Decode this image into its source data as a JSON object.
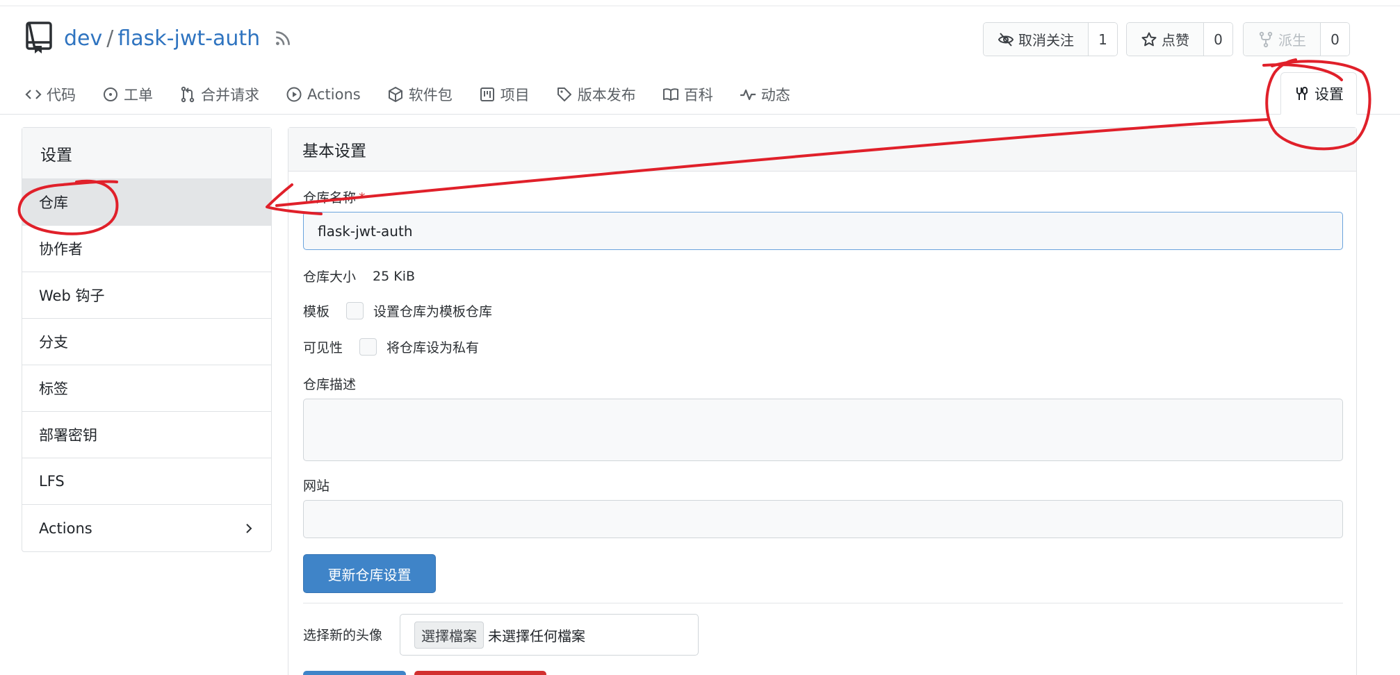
{
  "header": {
    "owner": "dev",
    "separator": "/",
    "repo_name": "flask-jwt-auth"
  },
  "actions": {
    "watch": {
      "label": "取消关注",
      "count": "1"
    },
    "star": {
      "label": "点赞",
      "count": "0"
    },
    "fork": {
      "label": "派生",
      "count": "0"
    }
  },
  "tabs": [
    {
      "label": "代码",
      "icon": "code-icon"
    },
    {
      "label": "工单",
      "icon": "issue-icon"
    },
    {
      "label": "合并请求",
      "icon": "pull-request-icon"
    },
    {
      "label": "Actions",
      "icon": "play-icon"
    },
    {
      "label": "软件包",
      "icon": "package-icon"
    },
    {
      "label": "项目",
      "icon": "project-icon"
    },
    {
      "label": "版本发布",
      "icon": "tag-icon"
    },
    {
      "label": "百科",
      "icon": "book-icon"
    },
    {
      "label": "动态",
      "icon": "pulse-icon"
    }
  ],
  "settings_tab": {
    "label": "设置",
    "icon": "tools-icon"
  },
  "sidebar": {
    "title": "设置",
    "items": [
      {
        "label": "仓库",
        "active": true
      },
      {
        "label": "协作者"
      },
      {
        "label": "Web 钩子"
      },
      {
        "label": "分支"
      },
      {
        "label": "标签"
      },
      {
        "label": "部署密钥"
      },
      {
        "label": "LFS"
      },
      {
        "label": "Actions"
      }
    ]
  },
  "main": {
    "panel_title": "基本设置",
    "repo_name_label": "仓库名称",
    "required_mark": "*",
    "repo_name_value": "flask-jwt-auth",
    "size_label": "仓库大小",
    "size_value": "25 KiB",
    "template_label": "模板",
    "template_checkbox_label": "设置仓库为模板仓库",
    "visibility_label": "可见性",
    "visibility_checkbox_label": "将仓库设为私有",
    "description_label": "仓库描述",
    "website_label": "网站",
    "update_button": "更新仓库设置",
    "avatar_label": "选择新的头像",
    "file_button": "選擇檔案",
    "file_none": "未選擇任何檔案"
  },
  "colors": {
    "link": "#2f74c0",
    "primary_button": "#3f84c8",
    "danger_button": "#d2302f",
    "annotation": "#e0202a"
  }
}
